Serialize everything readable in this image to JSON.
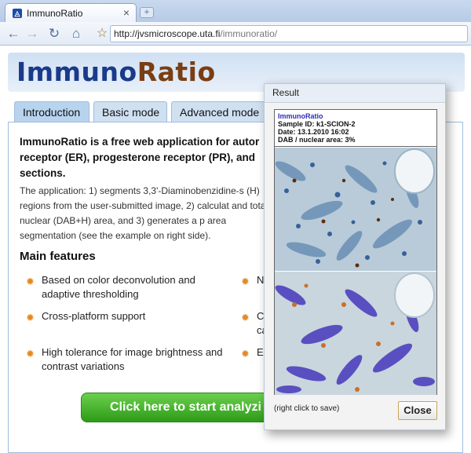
{
  "browser": {
    "tab_title": "ImmunoRatio",
    "tab_close": "×",
    "new_tab": "+",
    "url_host": "http://jvsmicroscope.uta.fi",
    "url_path": "/immunoratio/",
    "icons": [
      "back-icon",
      "forward-icon",
      "reload-icon",
      "home-icon",
      "star-icon"
    ]
  },
  "site": {
    "logo_part1": "Immuno",
    "logo_part2": "Ratio",
    "logo_colors": {
      "part1": "#1a3a8a",
      "part2": "#7a3e14"
    }
  },
  "tabs": [
    {
      "label": "Introduction",
      "active": true
    },
    {
      "label": "Basic mode",
      "active": false
    },
    {
      "label": "Advanced mode",
      "active": false
    }
  ],
  "intro": {
    "text": "ImmunoRatio is a free web application for autor receptor (ER), progesterone receptor (PR), and sections."
  },
  "application": {
    "text": "The application: 1) segments 3,3'-Diaminobenzidine-s (H) regions from the user-submitted image, 2) calculat and total nuclear (DAB+H) area, and 3) generates a p area segmentation (see the example on right side)."
  },
  "features": {
    "heading": "Main features",
    "items": [
      "Based on color deconvolution and adaptive thresholding",
      "Cross-platform support",
      "High tolerance for image brightness and contrast variations",
      "N",
      "C",
      "ca",
      "E"
    ]
  },
  "cta": {
    "label": "Click here to start analyzi"
  },
  "result": {
    "title": "Result",
    "meta_app": "ImmunoRatio",
    "meta_sample": "Sample ID: k1-SCION-2",
    "meta_date": "Date: 13.1.2010 16:02",
    "meta_ratio": "DAB / nuclear area: 3%",
    "save_note": "(right click to save)",
    "close_label": "Close"
  }
}
